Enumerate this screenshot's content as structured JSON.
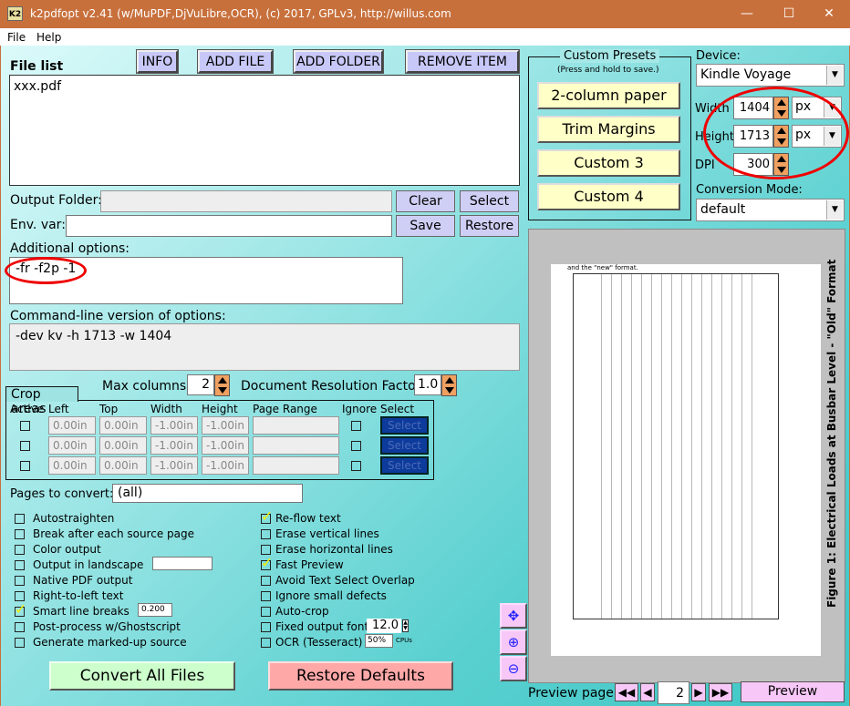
{
  "window": {
    "title": "k2pdfopt v2.41 (w/MuPDF,DjVuLibre,OCR), (c) 2017, GPLv3, http://willus.com",
    "icon_text": "K2",
    "minimize": "—",
    "maximize": "☐",
    "close": "✕"
  },
  "menu": [
    "File",
    "Help"
  ],
  "toolbar": {
    "info": "INFO",
    "add_file": "ADD FILE",
    "add_folder": "ADD FOLDER",
    "remove_item": "REMOVE ITEM"
  },
  "file_list": {
    "label": "File list",
    "items": [
      "xxx.pdf"
    ]
  },
  "output_folder": {
    "label": "Output Folder:",
    "value": "",
    "clear": "Clear",
    "select": "Select"
  },
  "env_var": {
    "label": "Env. var:",
    "value": "",
    "save": "Save",
    "restore": "Restore"
  },
  "additional_options": {
    "label": "Additional options:",
    "value": "-fr -f2p -1"
  },
  "command_line": {
    "label": "Command-line version of options:",
    "value": "-dev kv -h 1713 -w 1404"
  },
  "max_columns": {
    "label": "Max columns:",
    "value": "2"
  },
  "doc_res": {
    "label": "Document Resolution Factor:",
    "value": "1.0"
  },
  "crop": {
    "title": "Crop areas",
    "headers": [
      "Active",
      "Left",
      "Top",
      "Width",
      "Height",
      "Page Range",
      "Ignore",
      "Select"
    ],
    "rows": [
      {
        "left": "0.00in",
        "top": "0.00in",
        "width": "-1.00in",
        "height": "-1.00in",
        "range": "",
        "select": "Select"
      },
      {
        "left": "0.00in",
        "top": "0.00in",
        "width": "-1.00in",
        "height": "-1.00in",
        "range": "",
        "select": "Select"
      },
      {
        "left": "0.00in",
        "top": "0.00in",
        "width": "-1.00in",
        "height": "-1.00in",
        "range": "",
        "select": "Select"
      }
    ]
  },
  "pages": {
    "label": "Pages to convert:",
    "value": "(all)"
  },
  "options_left": [
    {
      "label": "Autostraighten",
      "checked": false
    },
    {
      "label": "Break after each source page",
      "checked": false
    },
    {
      "label": "Color output",
      "checked": false
    },
    {
      "label": "Output in landscape",
      "checked": false
    },
    {
      "label": "Native PDF output",
      "checked": false
    },
    {
      "label": "Right-to-left text",
      "checked": false
    },
    {
      "label": "Smart line breaks",
      "checked": true
    },
    {
      "label": "Post-process w/Ghostscript",
      "checked": false
    },
    {
      "label": "Generate marked-up source",
      "checked": false
    }
  ],
  "options_right": [
    {
      "label": "Re-flow text",
      "checked": true
    },
    {
      "label": "Erase vertical lines",
      "checked": false
    },
    {
      "label": "Erase horizontal lines",
      "checked": false
    },
    {
      "label": "Fast Preview",
      "checked": true
    },
    {
      "label": "Avoid Text Select Overlap",
      "checked": false
    },
    {
      "label": "Ignore small defects",
      "checked": false
    },
    {
      "label": "Auto-crop",
      "checked": false
    },
    {
      "label": "Fixed output font size",
      "checked": false
    },
    {
      "label": "OCR (Tesseract)",
      "checked": false
    }
  ],
  "landscape_value": "",
  "smart_line_value": "0.200",
  "font_size_value": "12.0",
  "ocr_cpus": "50%",
  "cpus_label": "CPUs",
  "convert": "Convert All Files",
  "restore_defaults": "Restore Defaults",
  "presets": {
    "title": "Custom Presets",
    "hint": "(Press and hold to save.)",
    "buttons": [
      "2-column paper",
      "Trim Margins",
      "Custom 3",
      "Custom 4"
    ]
  },
  "device": {
    "label": "Device:",
    "value": "Kindle Voyage",
    "width_label": "Width",
    "width": "1404",
    "width_unit": "px",
    "height_label": "Height",
    "height": "1713",
    "height_unit": "px",
    "dpi_label": "DPI",
    "dpi": "300",
    "mode_label": "Conversion Mode:",
    "mode": "default"
  },
  "preview": {
    "top_text": "and the \"new\" format.",
    "caption": "Figure 1: Electrical Loads at Busbar Level - \"Old\" Format",
    "page_label": "Preview page:",
    "page": "2",
    "button": "Preview",
    "first": "◀◀",
    "prev": "◀",
    "next": "▶",
    "last": "▶▶"
  },
  "colors": {
    "titlebar": "#c8703c",
    "button": "#c8c8f8",
    "preset": "#ffffc8",
    "convert": "#ccffcc",
    "restore": "#ffa8a8",
    "annotation": "#e00000"
  }
}
